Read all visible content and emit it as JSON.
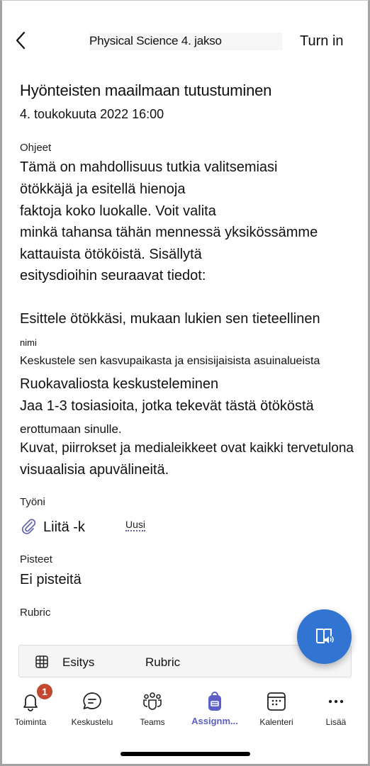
{
  "header": {
    "back_icon": "chevron-left-icon",
    "title": "Physical Science 4. jakso",
    "turn_in_label": "Turn in"
  },
  "assignment": {
    "title": "Hyönteisten maailmaan tutustuminen",
    "due": "4. toukokuuta 2022 16:00",
    "instructions_label": "Ohjeet",
    "instructions_lines": [
      "Tämä on mahdollisuus tutkia valitsemiasi",
      "ötökkäjä ja esitellä hienoja",
      "faktoja koko luokalle. Voit valita",
      "minkä tahansa tähän mennessä yksikössämme",
      "kattauista ötököistä. Sisällytä",
      "esitysdioihin seuraavat tiedot:",
      "",
      "Esittele ötökkäsi, mukaan lukien sen tieteellinen",
      "nimi",
      "Keskustele sen kasvupaikasta ja ensisijaisista asuinalueista",
      "Ruokavaliosta keskusteleminen",
      "Jaa 1-3 tosiasioita, jotka tekevät tästä ötököstä",
      "erottumaan sinulle.",
      "Kuvat, piirrokset ja medialeikkeet ovat kaikki tervetulona",
      "visuaalisia apuvälineitä."
    ],
    "my_work_label": "Työni",
    "attach_label": "Liitä -k",
    "new_label": "Uusi",
    "points_label": "Pisteet",
    "points_value": "Ei pisteitä",
    "rubric_label": "Rubric",
    "rubric_card": {
      "icon": "grid-icon",
      "name": "Esitys",
      "type": "Rubric"
    }
  },
  "fab": {
    "icon": "immersive-reader-icon"
  },
  "tabbar": {
    "active_color": "#5b5fc7",
    "items": [
      {
        "label": "Toiminta",
        "icon": "bell-icon",
        "badge": "1"
      },
      {
        "label": "Keskustelu",
        "icon": "chat-icon"
      },
      {
        "label": "Teams",
        "icon": "teams-icon"
      },
      {
        "label": "Assignm...",
        "icon": "backpack-icon",
        "active": true
      },
      {
        "label": "Kalenteri",
        "icon": "calendar-icon"
      },
      {
        "label": "Lisää",
        "icon": "more-icon"
      }
    ]
  },
  "colors": {
    "accent": "#5b5fc7",
    "fab": "#3174d1",
    "badge": "#c4472f"
  }
}
